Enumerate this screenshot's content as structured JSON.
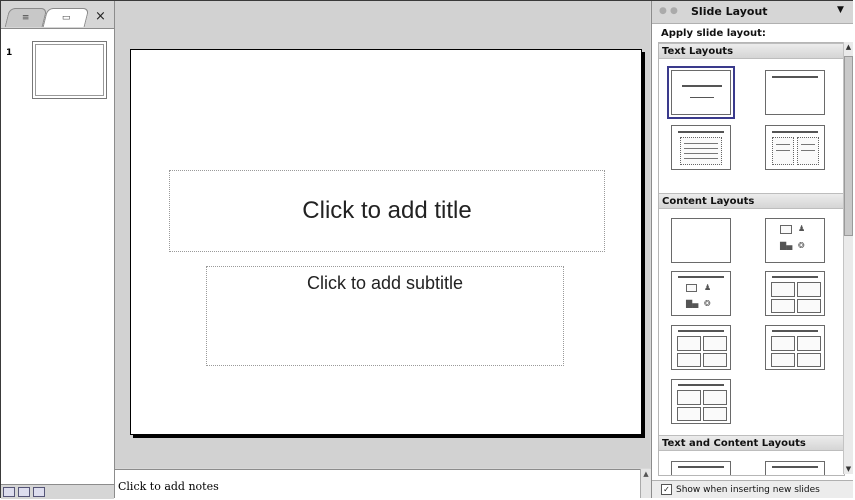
{
  "left_pane": {
    "tab_outline_icon": "outline-tab-icon",
    "tab_slides_icon": "slides-tab-icon",
    "close_glyph": "×",
    "slides": [
      {
        "number": "1"
      }
    ]
  },
  "slide": {
    "title_placeholder": "Click to add title",
    "subtitle_placeholder": "Click to add subtitle"
  },
  "notes": {
    "placeholder": "Click to add notes"
  },
  "task_pane": {
    "title": "Slide Layout",
    "apply_label": "Apply slide layout:",
    "sections": [
      {
        "name": "Text Layouts"
      },
      {
        "name": "Content Layouts"
      },
      {
        "name": "Text and Content Layouts"
      }
    ],
    "footer_checkbox_label": "Show when inserting new slides",
    "footer_checked": true
  },
  "colors": {
    "selection_outline": "#3a3a8c",
    "canvas_bg": "#d2d2d2",
    "pane_header_bg": "#d6d6d6"
  }
}
